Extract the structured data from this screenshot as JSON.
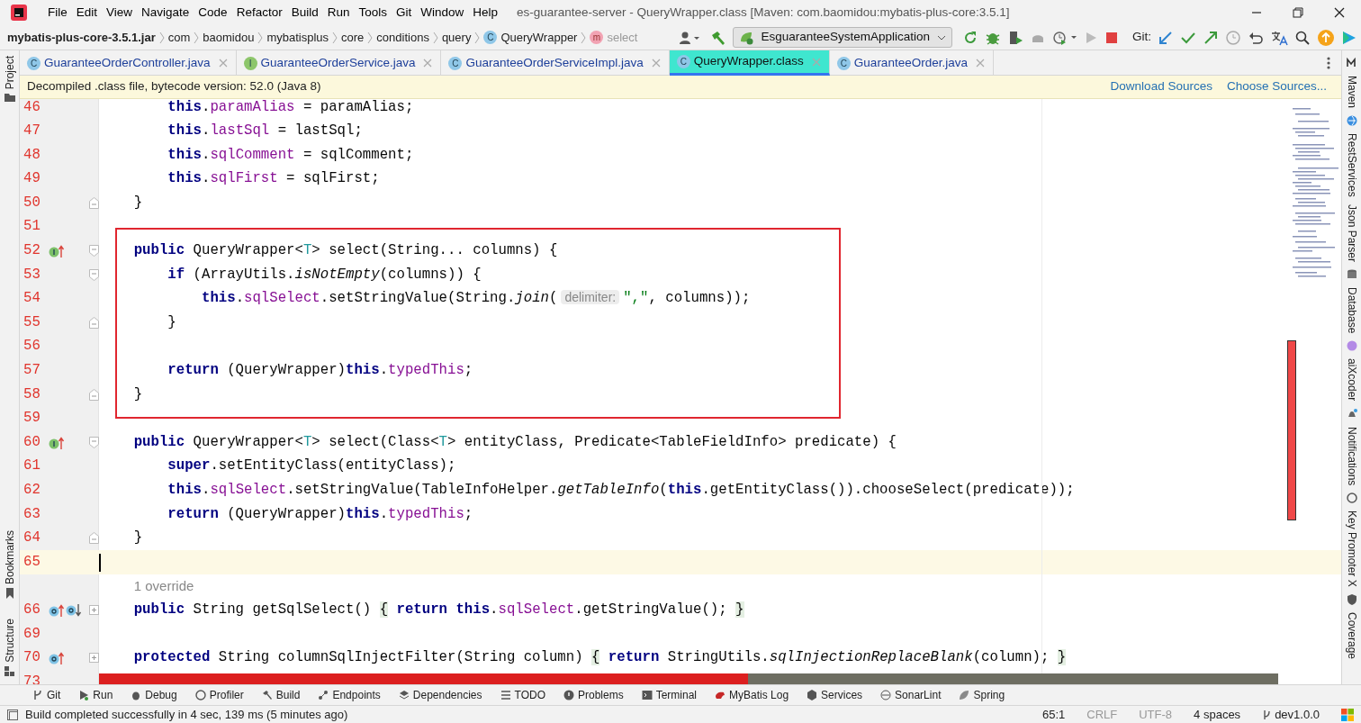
{
  "window": {
    "title": "es-guarantee-server - QueryWrapper.class [Maven: com.baomidou:mybatis-plus-core:3.5.1]"
  },
  "menu": [
    "File",
    "Edit",
    "View",
    "Navigate",
    "Code",
    "Refactor",
    "Build",
    "Run",
    "Tools",
    "Git",
    "Window",
    "Help"
  ],
  "breadcrumb": [
    {
      "label": "mybatis-plus-core-3.5.1.jar",
      "kind": "jar"
    },
    {
      "label": "com",
      "kind": "package"
    },
    {
      "label": "baomidou",
      "kind": "package"
    },
    {
      "label": "mybatisplus",
      "kind": "package"
    },
    {
      "label": "core",
      "kind": "package"
    },
    {
      "label": "conditions",
      "kind": "package"
    },
    {
      "label": "query",
      "kind": "package"
    },
    {
      "label": "QueryWrapper",
      "kind": "class",
      "badge": "C"
    },
    {
      "label": "select",
      "kind": "method",
      "badge": "m"
    }
  ],
  "toolbar": {
    "run_config": "EsguaranteeSystemApplication",
    "git_label": "Git:"
  },
  "tabs": [
    {
      "label": "GuaranteeOrderController.java",
      "badge": "C",
      "kind": "class",
      "selected": false
    },
    {
      "label": "GuaranteeOrderService.java",
      "badge": "I",
      "kind": "interface",
      "selected": false
    },
    {
      "label": "GuaranteeOrderServiceImpl.java",
      "badge": "C",
      "kind": "class",
      "selected": false
    },
    {
      "label": "QueryWrapper.class",
      "badge": "C",
      "kind": "class",
      "selected": true
    },
    {
      "label": "GuaranteeOrder.java",
      "badge": "C",
      "kind": "class",
      "selected": false
    }
  ],
  "banner": {
    "message": "Decompiled .class file, bytecode version: 52.0 (Java 8)",
    "actions": [
      "Download Sources",
      "Choose Sources..."
    ]
  },
  "left_tools": [
    "Project",
    "Bookmarks",
    "Structure"
  ],
  "right_tools": [
    "Maven",
    "RestServices",
    "Json Parser",
    "Database",
    "aiXcoder",
    "Notifications",
    "Key Promoter X",
    "Coverage"
  ],
  "editor": {
    "rows": [
      {
        "kind": "code",
        "number": "46",
        "tokens": [
          {
            "kind": "kw",
            "text": "        this"
          },
          {
            "kind": "plain",
            "text": "."
          },
          {
            "kind": "field",
            "text": "paramAlias"
          },
          {
            "kind": "plain",
            "text": " = paramAlias;"
          }
        ],
        "current": false
      },
      {
        "kind": "code",
        "number": "47",
        "tokens": [
          {
            "kind": "kw",
            "text": "        this"
          },
          {
            "kind": "plain",
            "text": "."
          },
          {
            "kind": "field",
            "text": "lastSql"
          },
          {
            "kind": "plain",
            "text": " = lastSql;"
          }
        ],
        "current": false
      },
      {
        "kind": "code",
        "number": "48",
        "tokens": [
          {
            "kind": "kw",
            "text": "        this"
          },
          {
            "kind": "plain",
            "text": "."
          },
          {
            "kind": "field",
            "text": "sqlComment"
          },
          {
            "kind": "plain",
            "text": " = sqlComment;"
          }
        ],
        "current": false
      },
      {
        "kind": "code",
        "number": "49",
        "tokens": [
          {
            "kind": "kw",
            "text": "        this"
          },
          {
            "kind": "plain",
            "text": "."
          },
          {
            "kind": "field",
            "text": "sqlFirst"
          },
          {
            "kind": "plain",
            "text": " = sqlFirst;"
          }
        ],
        "current": false
      },
      {
        "kind": "code",
        "number": "50",
        "tokens": [
          {
            "kind": "plain",
            "text": "    }"
          }
        ],
        "current": false,
        "fold": {
          "kind": "end"
        }
      },
      {
        "kind": "code",
        "number": "51",
        "current": false
      },
      {
        "kind": "highlight",
        "children": [
          {
            "kind": "code",
            "number": "52",
            "tokens": [
              {
                "kind": "kw",
                "text": "    public"
              },
              {
                "kind": "plain",
                "text": " QueryWrapper<"
              },
              {
                "kind": "type",
                "text": "T"
              },
              {
                "kind": "plain",
                "text": "> select(String... columns) {"
              }
            ],
            "current": false,
            "marks": [
              {
                "kind": "implements"
              }
            ],
            "fold": {
              "kind": "start"
            }
          },
          {
            "kind": "code",
            "number": "53",
            "tokens": [
              {
                "kind": "kw",
                "text": "        if"
              },
              {
                "kind": "plain",
                "text": " (ArrayUtils."
              },
              {
                "kind": "static",
                "text": "isNotEmpty"
              },
              {
                "kind": "plain",
                "text": "(columns)) {"
              }
            ],
            "current": false,
            "fold": {
              "kind": "start"
            }
          },
          {
            "kind": "code",
            "number": "54",
            "tokens": [
              {
                "kind": "kw",
                "text": "            this"
              },
              {
                "kind": "plain",
                "text": "."
              },
              {
                "kind": "field",
                "text": "sqlSelect"
              },
              {
                "kind": "plain",
                "text": ".setStringValue(String."
              },
              {
                "kind": "static",
                "text": "join"
              },
              {
                "kind": "plain",
                "text": "("
              },
              {
                "kind": "hint",
                "text": "delimiter:"
              },
              {
                "kind": "str",
                "text": "\",\""
              },
              {
                "kind": "plain",
                "text": ", columns));"
              }
            ],
            "current": false
          },
          {
            "kind": "code",
            "number": "55",
            "tokens": [
              {
                "kind": "plain",
                "text": "        }"
              }
            ],
            "current": false,
            "fold": {
              "kind": "end"
            }
          },
          {
            "kind": "code",
            "number": "56",
            "current": false
          },
          {
            "kind": "code",
            "number": "57",
            "tokens": [
              {
                "kind": "kw",
                "text": "        return"
              },
              {
                "kind": "plain",
                "text": " (QueryWrapper)"
              },
              {
                "kind": "kw",
                "text": "this"
              },
              {
                "kind": "plain",
                "text": "."
              },
              {
                "kind": "field",
                "text": "typedThis"
              },
              {
                "kind": "plain",
                "text": ";"
              }
            ],
            "current": false
          },
          {
            "kind": "code",
            "number": "58",
            "tokens": [
              {
                "kind": "plain",
                "text": "    }"
              }
            ],
            "current": false,
            "fold": {
              "kind": "end"
            }
          }
        ]
      },
      {
        "kind": "code",
        "number": "59",
        "current": false
      },
      {
        "kind": "code",
        "number": "60",
        "tokens": [
          {
            "kind": "kw",
            "text": "    public"
          },
          {
            "kind": "plain",
            "text": " QueryWrapper<"
          },
          {
            "kind": "type",
            "text": "T"
          },
          {
            "kind": "plain",
            "text": "> select(Class<"
          },
          {
            "kind": "type",
            "text": "T"
          },
          {
            "kind": "plain",
            "text": "> entityClass, Predicate<TableFieldInfo> predicate) {"
          }
        ],
        "current": false,
        "marks": [
          {
            "kind": "implements"
          }
        ],
        "fold": {
          "kind": "start"
        }
      },
      {
        "kind": "code",
        "number": "61",
        "tokens": [
          {
            "kind": "kw",
            "text": "        super"
          },
          {
            "kind": "plain",
            "text": ".setEntityClass(entityClass);"
          }
        ],
        "current": false
      },
      {
        "kind": "code",
        "number": "62",
        "tokens": [
          {
            "kind": "kw",
            "text": "        this"
          },
          {
            "kind": "plain",
            "text": "."
          },
          {
            "kind": "field",
            "text": "sqlSelect"
          },
          {
            "kind": "plain",
            "text": ".setStringValue(TableInfoHelper."
          },
          {
            "kind": "static",
            "text": "getTableInfo"
          },
          {
            "kind": "plain",
            "text": "("
          },
          {
            "kind": "kw",
            "text": "this"
          },
          {
            "kind": "plain",
            "text": ".getEntityClass()).chooseSelect(predicate));"
          }
        ],
        "current": false
      },
      {
        "kind": "code",
        "number": "63",
        "tokens": [
          {
            "kind": "kw",
            "text": "        return"
          },
          {
            "kind": "plain",
            "text": " (QueryWrapper)"
          },
          {
            "kind": "kw",
            "text": "this"
          },
          {
            "kind": "plain",
            "text": "."
          },
          {
            "kind": "field",
            "text": "typedThis"
          },
          {
            "kind": "plain",
            "text": ";"
          }
        ],
        "current": false
      },
      {
        "kind": "code",
        "number": "64",
        "tokens": [
          {
            "kind": "plain",
            "text": "    }"
          }
        ],
        "current": false,
        "fold": {
          "kind": "end"
        }
      },
      {
        "kind": "code",
        "number": "65",
        "current": true
      },
      {
        "kind": "inlay",
        "text": "1 override"
      },
      {
        "kind": "code",
        "number": "66",
        "tokens": [
          {
            "kind": "kw",
            "text": "    public"
          },
          {
            "kind": "plain",
            "text": " String getSqlSelect() "
          },
          {
            "kind": "fold",
            "text": "{"
          },
          {
            "kind": "kw",
            "text": " return this"
          },
          {
            "kind": "plain",
            "text": "."
          },
          {
            "kind": "field",
            "text": "sqlSelect"
          },
          {
            "kind": "plain",
            "text": ".getStringValue(); "
          },
          {
            "kind": "fold",
            "text": "}"
          }
        ],
        "current": false,
        "marks": [
          {
            "kind": "overrides"
          },
          {
            "kind": "overridden"
          }
        ],
        "fold": {
          "kind": "collapsed"
        }
      },
      {
        "kind": "code",
        "number": "69",
        "current": false
      },
      {
        "kind": "code",
        "number": "70",
        "tokens": [
          {
            "kind": "kw",
            "text": "    protected"
          },
          {
            "kind": "plain",
            "text": " String columnSqlInjectFilter(String column) "
          },
          {
            "kind": "fold",
            "text": "{"
          },
          {
            "kind": "kw",
            "text": " return"
          },
          {
            "kind": "plain",
            "text": " StringUtils."
          },
          {
            "kind": "static",
            "text": "sqlInjectionReplaceBlank"
          },
          {
            "kind": "plain",
            "text": "(column); "
          },
          {
            "kind": "fold",
            "text": "}"
          }
        ],
        "current": false,
        "marks": [
          {
            "kind": "overrides"
          }
        ],
        "fold": {
          "kind": "collapsed"
        }
      },
      {
        "kind": "code",
        "number": "73",
        "current": false
      }
    ]
  },
  "tool_windows": [
    "Git",
    "Run",
    "Debug",
    "Profiler",
    "Build",
    "Endpoints",
    "Dependencies",
    "TODO",
    "Problems",
    "Terminal",
    "MyBatis Log",
    "Services",
    "SonarLint",
    "Spring"
  ],
  "status_bar": {
    "message": "Build completed successfully in 4 sec, 139 ms (5 minutes ago)",
    "position": "65:1",
    "line_separator": "CRLF",
    "encoding": "UTF-8",
    "indent": "4 spaces",
    "branch": "dev1.0.0"
  }
}
